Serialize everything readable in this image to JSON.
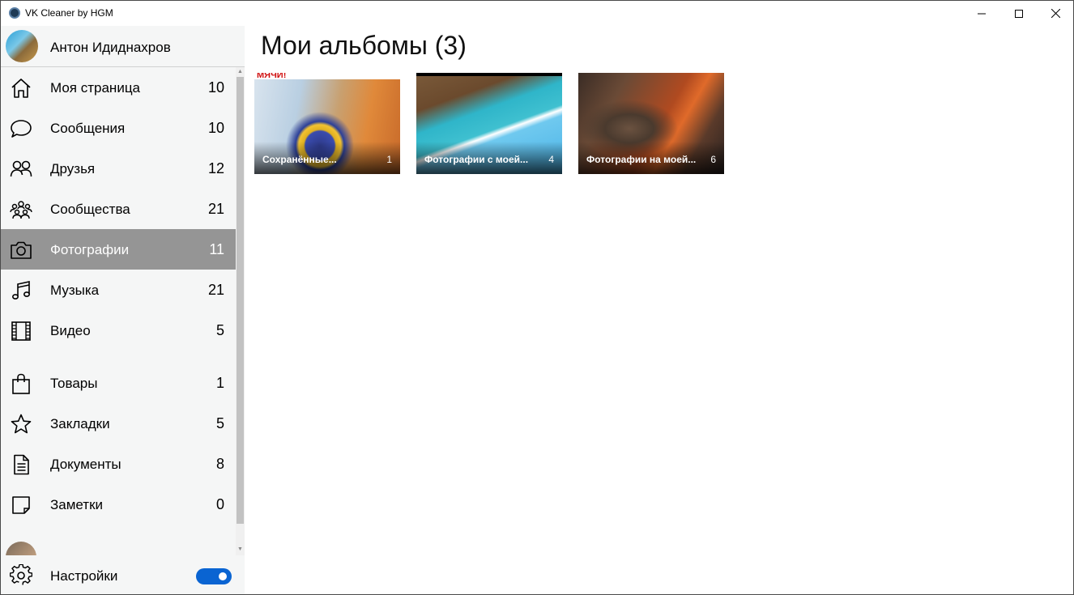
{
  "window": {
    "title": "VK Cleaner by HGM"
  },
  "profile": {
    "name": "Антон Идиднахров"
  },
  "nav": [
    {
      "label": "Моя страница",
      "count": "10",
      "icon": "home-icon"
    },
    {
      "label": "Сообщения",
      "count": "10",
      "icon": "chat-bubble-icon"
    },
    {
      "label": "Друзья",
      "count": "12",
      "icon": "friends-icon"
    },
    {
      "label": "Сообщества",
      "count": "21",
      "icon": "groups-icon"
    },
    {
      "label": "Фотографии",
      "count": "11",
      "icon": "camera-icon",
      "active": true
    },
    {
      "label": "Музыка",
      "count": "21",
      "icon": "music-note-icon"
    },
    {
      "label": "Видео",
      "count": "5",
      "icon": "film-icon"
    },
    {
      "label": "Товары",
      "count": "1",
      "icon": "shopping-bag-icon"
    },
    {
      "label": "Закладки",
      "count": "5",
      "icon": "star-icon"
    },
    {
      "label": "Документы",
      "count": "8",
      "icon": "document-icon"
    },
    {
      "label": "Заметки",
      "count": "0",
      "icon": "note-icon"
    }
  ],
  "settings": {
    "label": "Настройки",
    "toggle_on": true
  },
  "main": {
    "title": "Мои альбомы (3)",
    "albums": [
      {
        "title": "Сохранённые...",
        "count": "1",
        "thumb_text": "МЯЧИ!"
      },
      {
        "title": "Фотографии с моей...",
        "count": "4"
      },
      {
        "title": "Фотографии на моей...",
        "count": "6"
      }
    ]
  },
  "colors": {
    "active_item_bg": "#959595",
    "sidebar_bg": "#f5f6f6",
    "toggle_accent": "#0a64d2"
  }
}
